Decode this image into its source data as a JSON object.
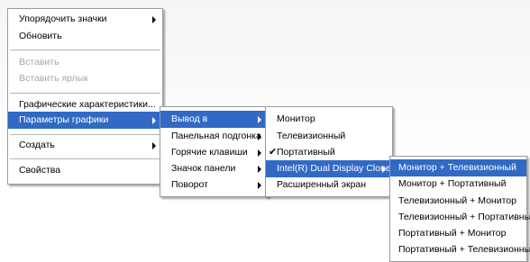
{
  "menu_main": {
    "items": [
      {
        "label": "Упорядочить значки",
        "submenu": true
      },
      {
        "label": "Обновить"
      },
      {
        "label": "Вставить",
        "disabled": true
      },
      {
        "label": "Вставить ярлык",
        "disabled": true
      },
      {
        "label": "Графические характеристики..."
      },
      {
        "label": "Параметры графики",
        "submenu": true,
        "highlighted": true
      },
      {
        "label": "Создать",
        "submenu": true
      },
      {
        "label": "Свойства"
      }
    ]
  },
  "menu_graphics": {
    "items": [
      {
        "label": "Вывод в",
        "submenu": true,
        "highlighted": true
      },
      {
        "label": "Панельная подгонка",
        "submenu": true
      },
      {
        "label": "Горячие клавиши",
        "submenu": true
      },
      {
        "label": "Значок панели",
        "submenu": true
      },
      {
        "label": "Поворот",
        "submenu": true
      }
    ]
  },
  "menu_output": {
    "items": [
      {
        "label": "Монитор"
      },
      {
        "label": "Телевизионный"
      },
      {
        "label": "Портативный",
        "checked": true
      },
      {
        "label": "Intel(R) Dual Display Clone",
        "submenu": true,
        "highlighted": true
      },
      {
        "label": "Расширенный экран"
      }
    ],
    "check_glyph": "✔"
  },
  "menu_clone": {
    "items": [
      {
        "label": "Монитор + Телевизионный",
        "highlighted": true
      },
      {
        "label": "Монитор + Портативный"
      },
      {
        "label": "Телевизионный + Монитор"
      },
      {
        "label": "Телевизионный + Портативный"
      },
      {
        "label": "Портативный + Монитор"
      },
      {
        "label": "Портативный + Телевизионный"
      }
    ]
  },
  "colors": {
    "highlight": "#316ac5",
    "disabled": "#a7a7a7"
  }
}
